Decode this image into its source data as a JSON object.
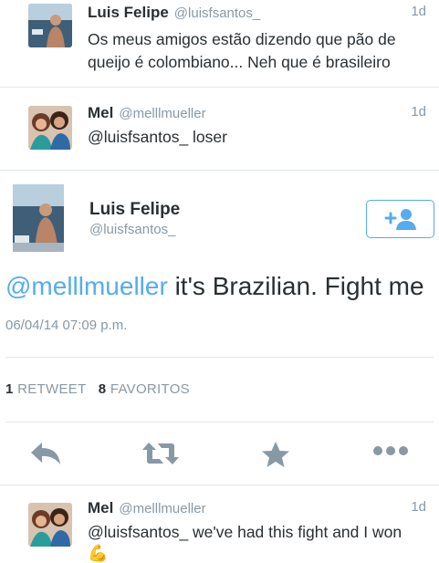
{
  "tweets_above": [
    {
      "name": "Luis Felipe",
      "handle": "@luisfsantos_",
      "time": "1d",
      "text": "Os meus amigos estão dizendo que pão de queijo é colombiano... Neh que é brasileiro"
    },
    {
      "name": "Mel",
      "handle": "@melllmueller",
      "time": "1d",
      "text": "@luisfsantos_ loser"
    }
  ],
  "main_tweet": {
    "name": "Luis Felipe",
    "handle": "@luisfsantos_",
    "mention": "@melllmueller",
    "text_rest": " it's Brazilian. Fight me",
    "timestamp": "06/04/14 07:09 p.m.",
    "retweet_count": "1",
    "retweet_label": "RETWEET",
    "favorite_count": "8",
    "favorite_label": "FAVORITOS"
  },
  "actions": [
    "reply-icon",
    "retweet-icon",
    "favorite-icon",
    "more-icon"
  ],
  "reply_below": {
    "name": "Mel",
    "handle": "@melllmueller",
    "time": "1d",
    "text": "@luisfsantos_ we've had this fight and I won",
    "emoji": "💪"
  },
  "colors": {
    "accent": "#55acee",
    "muted": "#8899a6",
    "text": "#292f33",
    "divider": "#e1e8ed",
    "icon": "#8899a6"
  }
}
